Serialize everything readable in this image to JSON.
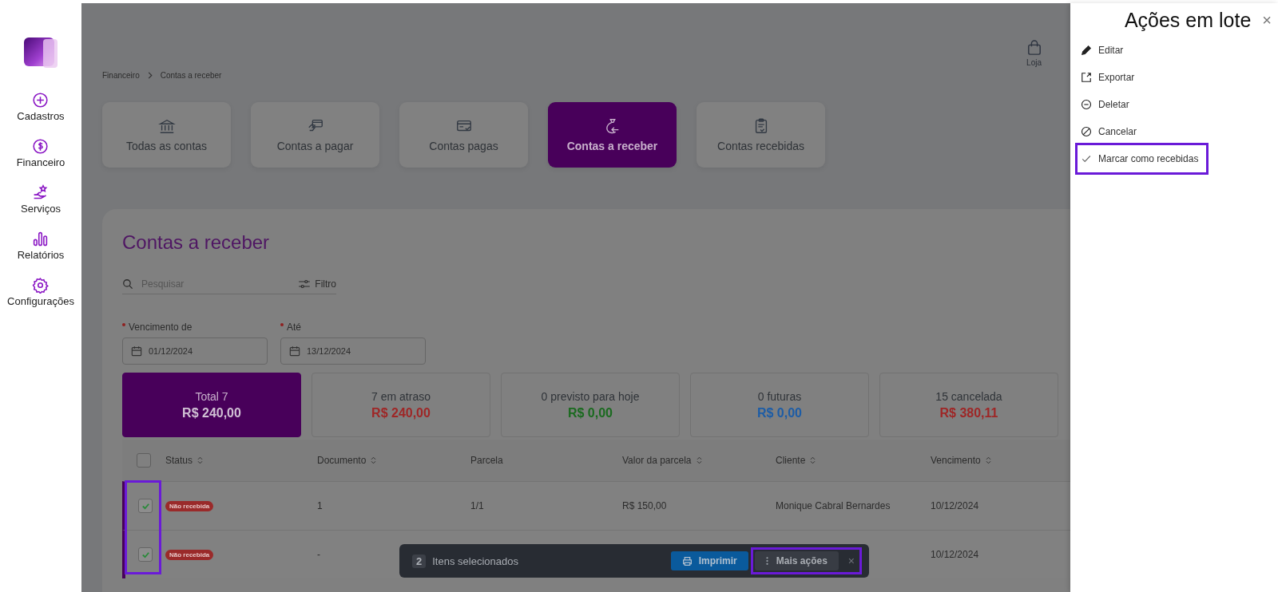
{
  "sidebar": {
    "items": [
      {
        "label": "Cadastros"
      },
      {
        "label": "Financeiro"
      },
      {
        "label": "Serviços"
      },
      {
        "label": "Relatórios"
      },
      {
        "label": "Configurações"
      }
    ]
  },
  "topbar": {
    "store_label": "Loja"
  },
  "breadcrumb": [
    "Financeiro",
    "Contas a receber"
  ],
  "tabs": [
    {
      "label": "Todas as contas",
      "selected": false
    },
    {
      "label": "Contas a pagar",
      "selected": false
    },
    {
      "label": "Contas pagas",
      "selected": false
    },
    {
      "label": "Contas a receber",
      "selected": true
    },
    {
      "label": "Contas recebidas",
      "selected": false
    }
  ],
  "panel": {
    "title": "Contas a receber",
    "search": {
      "placeholder": "Pesquisar"
    },
    "filter_label": "Filtro",
    "date_from": {
      "label": "Vencimento de",
      "value": "01/12/2024"
    },
    "date_to": {
      "label": "Até",
      "value": "13/12/2024"
    }
  },
  "summary": [
    {
      "label": "Total 7",
      "amount": "R$ 240,00",
      "selected": true,
      "color": "#d0c0d4"
    },
    {
      "label": "7 em atraso",
      "amount": "R$ 240,00",
      "selected": false,
      "color": "#9e2626"
    },
    {
      "label": "0 previsto para hoje",
      "amount": "R$ 0,00",
      "selected": false,
      "color": "#1a6a1f"
    },
    {
      "label": "0 futuras",
      "amount": "R$ 0,00",
      "selected": false,
      "color": "#1c5ca6"
    },
    {
      "label": "15 cancelada",
      "amount": "R$ 380,11",
      "selected": false,
      "color": "#9e2626"
    }
  ],
  "table": {
    "checkbox_column_highlighted": true,
    "all_checked": false,
    "columns": [
      {
        "label": "Status",
        "sortable": true
      },
      {
        "label": "Documento",
        "sortable": true
      },
      {
        "label": "Parcela",
        "sortable": false
      },
      {
        "label": "Valor da parcela",
        "sortable": true
      },
      {
        "label": "Cliente",
        "sortable": true
      },
      {
        "label": "Vencimento",
        "sortable": true
      }
    ],
    "rows": [
      {
        "checked": true,
        "status": "Não recebida",
        "documento": "1",
        "parcela": "1/1",
        "valor": "R$  150,00",
        "cliente": "Monique Cabral Bernardes",
        "vencimento": "10/12/2024"
      },
      {
        "checked": true,
        "status": "Não recebida",
        "documento": "-",
        "vencimento": "10/12/2024"
      }
    ]
  },
  "selection_bar": {
    "count": "2",
    "label": "Itens selecionados",
    "print_label": "Imprimir",
    "more_label": "Mais ações",
    "more_highlighted": true,
    "close": "×"
  },
  "drawer": {
    "title": "Ações em lote",
    "close": "×",
    "items": [
      {
        "label": "Editar",
        "highlighted": false
      },
      {
        "label": "Exportar",
        "highlighted": false
      },
      {
        "label": "Deletar",
        "highlighted": false
      },
      {
        "label": "Cancelar",
        "highlighted": false
      },
      {
        "label": "Marcar como recebidas",
        "highlighted": true
      }
    ]
  }
}
